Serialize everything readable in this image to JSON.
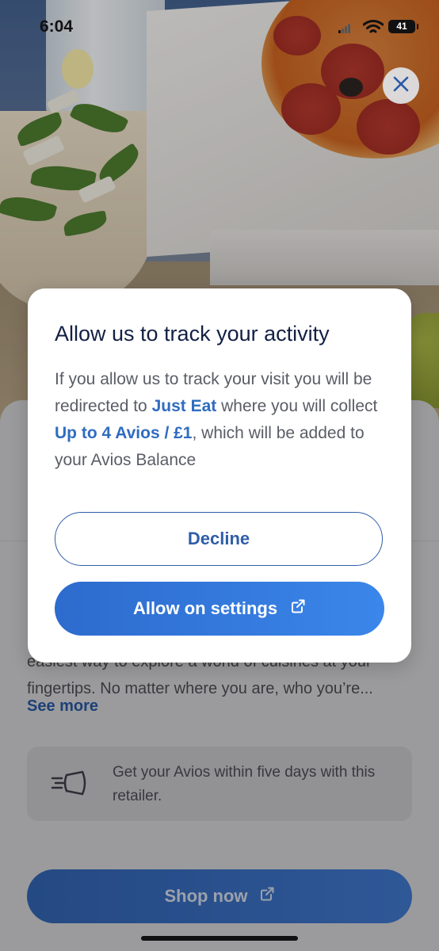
{
  "status_bar": {
    "time": "6:04",
    "battery": "41"
  },
  "hero": {
    "close_icon": "close-icon"
  },
  "sheet": {
    "description_line1": "easiest way to explore a world of cuisines at your",
    "description_line2": "fingertips. No matter where you are, who you’re...",
    "see_more": "See more",
    "info_text": "Get your Avios within five days with this retailer.",
    "info_icon": "fast-delivery-icon",
    "shop_now": "Shop now"
  },
  "modal": {
    "title": "Allow us to track your activity",
    "body_part1": "If you allow us to track your visit you will be redirected to ",
    "retailer": "Just Eat",
    "body_part2": " where you will collect ",
    "rate": "Up to 4 Avios / £1",
    "body_part3": ", which will be added to your Avios Balance",
    "decline": "Decline",
    "allow": "Allow on settings"
  },
  "colors": {
    "primary": "#2f6cc0",
    "title": "#132044",
    "button_gradient_start": "#2d6bcd",
    "button_gradient_end": "#3b86ea"
  }
}
